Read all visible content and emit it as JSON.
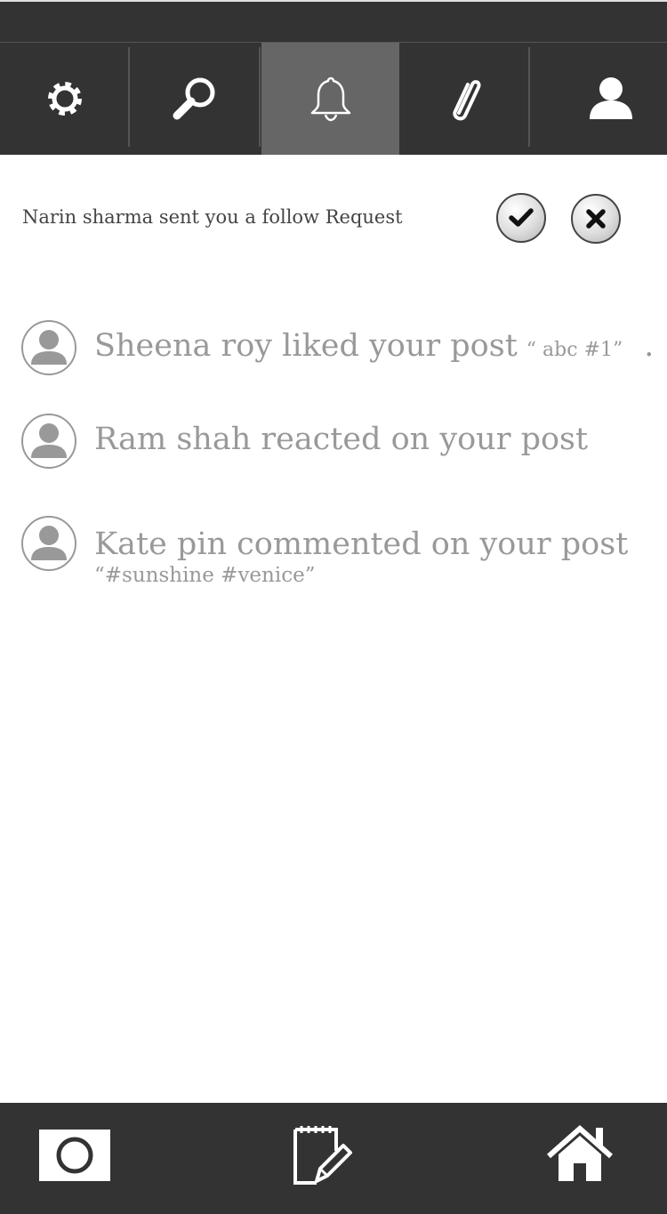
{
  "top_nav": {
    "tabs": [
      {
        "icon": "gear-icon",
        "active": false
      },
      {
        "icon": "search-icon",
        "active": false
      },
      {
        "icon": "bell-icon",
        "active": true
      },
      {
        "icon": "paperclip-icon",
        "active": false
      },
      {
        "icon": "user-icon",
        "active": false
      }
    ]
  },
  "follow_request": {
    "text": "Narin sharma sent you a follow Request",
    "accept_icon": "check-icon",
    "decline_icon": "close-icon"
  },
  "notifications": [
    {
      "text": "Sheena roy liked your post",
      "quote": "“ abc #1”",
      "trailing": "."
    },
    {
      "text": "Ram shah reacted on your post"
    },
    {
      "text": "Kate pin  commented on your post",
      "subtext": "“#sunshine #venice”"
    }
  ],
  "bottom_nav": {
    "items": [
      {
        "icon": "camera-icon"
      },
      {
        "icon": "edit-note-icon"
      },
      {
        "icon": "home-icon"
      }
    ]
  },
  "colors": {
    "nav_background": "#333333",
    "active_tab": "#666666",
    "notification_text": "#999999",
    "request_text": "#444444"
  }
}
